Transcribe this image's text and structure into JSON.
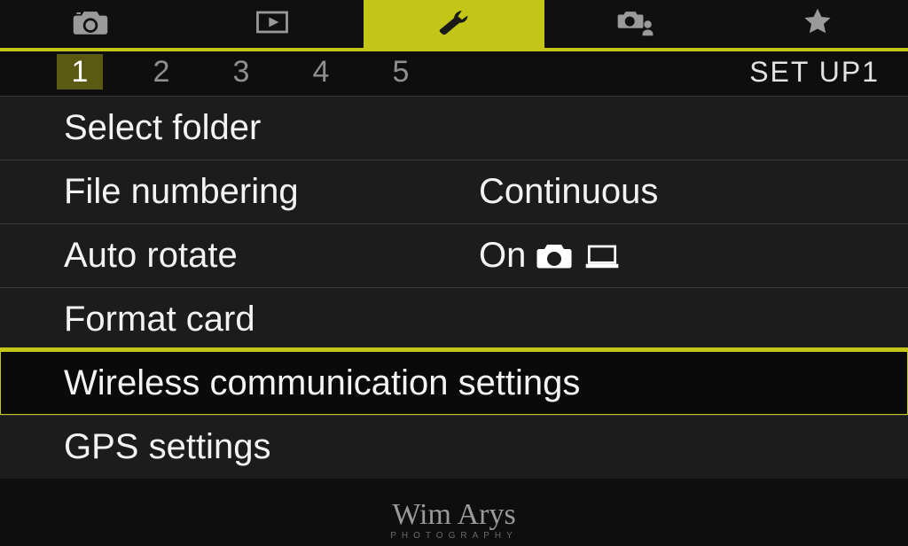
{
  "top_tabs": [
    {
      "name": "shoot-tab",
      "icon": "camera",
      "active": false
    },
    {
      "name": "play-tab",
      "icon": "play",
      "active": false
    },
    {
      "name": "setup-tab",
      "icon": "wrench",
      "active": true
    },
    {
      "name": "custom-tab",
      "icon": "camera-person",
      "active": false
    },
    {
      "name": "mymenu-tab",
      "icon": "star",
      "active": false
    }
  ],
  "sub_tabs": {
    "items": [
      "1",
      "2",
      "3",
      "4",
      "5"
    ],
    "active_index": 0,
    "page_label": "SET UP1"
  },
  "menu": [
    {
      "label": "Select folder",
      "value": "",
      "selected": false
    },
    {
      "label": "File numbering",
      "value": "Continuous",
      "selected": false
    },
    {
      "label": "Auto rotate",
      "value": "On",
      "value_icons": [
        "camera-solid",
        "laptop"
      ],
      "selected": false
    },
    {
      "label": "Format card",
      "value": "",
      "selected": false
    },
    {
      "label": "Wireless communication settings",
      "value": "",
      "selected": true
    },
    {
      "label": "GPS settings",
      "value": "",
      "selected": false
    }
  ],
  "watermark": {
    "main": "Wim Arys",
    "sub": "PHOTOGRAPHY"
  }
}
